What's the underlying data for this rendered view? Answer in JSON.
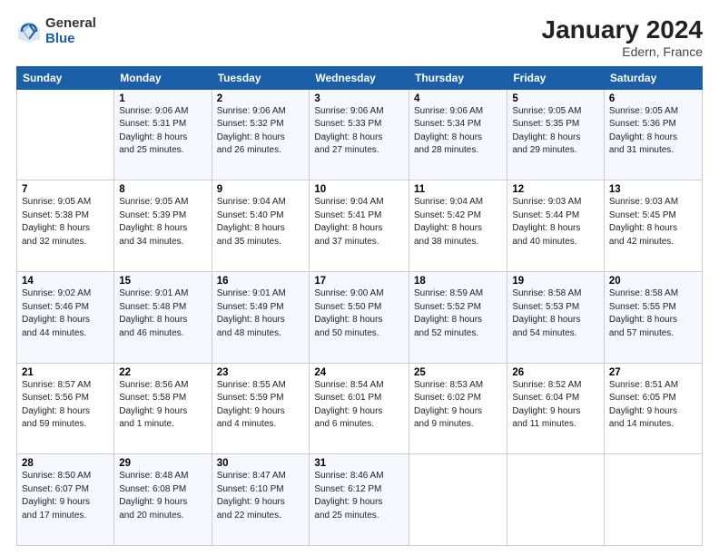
{
  "header": {
    "logo_general": "General",
    "logo_blue": "Blue",
    "title": "January 2024",
    "subtitle": "Edern, France"
  },
  "columns": [
    "Sunday",
    "Monday",
    "Tuesday",
    "Wednesday",
    "Thursday",
    "Friday",
    "Saturday"
  ],
  "weeks": [
    [
      {
        "day": "",
        "info": ""
      },
      {
        "day": "1",
        "info": "Sunrise: 9:06 AM\nSunset: 5:31 PM\nDaylight: 8 hours\nand 25 minutes."
      },
      {
        "day": "2",
        "info": "Sunrise: 9:06 AM\nSunset: 5:32 PM\nDaylight: 8 hours\nand 26 minutes."
      },
      {
        "day": "3",
        "info": "Sunrise: 9:06 AM\nSunset: 5:33 PM\nDaylight: 8 hours\nand 27 minutes."
      },
      {
        "day": "4",
        "info": "Sunrise: 9:06 AM\nSunset: 5:34 PM\nDaylight: 8 hours\nand 28 minutes."
      },
      {
        "day": "5",
        "info": "Sunrise: 9:05 AM\nSunset: 5:35 PM\nDaylight: 8 hours\nand 29 minutes."
      },
      {
        "day": "6",
        "info": "Sunrise: 9:05 AM\nSunset: 5:36 PM\nDaylight: 8 hours\nand 31 minutes."
      }
    ],
    [
      {
        "day": "7",
        "info": "Sunrise: 9:05 AM\nSunset: 5:38 PM\nDaylight: 8 hours\nand 32 minutes."
      },
      {
        "day": "8",
        "info": "Sunrise: 9:05 AM\nSunset: 5:39 PM\nDaylight: 8 hours\nand 34 minutes."
      },
      {
        "day": "9",
        "info": "Sunrise: 9:04 AM\nSunset: 5:40 PM\nDaylight: 8 hours\nand 35 minutes."
      },
      {
        "day": "10",
        "info": "Sunrise: 9:04 AM\nSunset: 5:41 PM\nDaylight: 8 hours\nand 37 minutes."
      },
      {
        "day": "11",
        "info": "Sunrise: 9:04 AM\nSunset: 5:42 PM\nDaylight: 8 hours\nand 38 minutes."
      },
      {
        "day": "12",
        "info": "Sunrise: 9:03 AM\nSunset: 5:44 PM\nDaylight: 8 hours\nand 40 minutes."
      },
      {
        "day": "13",
        "info": "Sunrise: 9:03 AM\nSunset: 5:45 PM\nDaylight: 8 hours\nand 42 minutes."
      }
    ],
    [
      {
        "day": "14",
        "info": "Sunrise: 9:02 AM\nSunset: 5:46 PM\nDaylight: 8 hours\nand 44 minutes."
      },
      {
        "day": "15",
        "info": "Sunrise: 9:01 AM\nSunset: 5:48 PM\nDaylight: 8 hours\nand 46 minutes."
      },
      {
        "day": "16",
        "info": "Sunrise: 9:01 AM\nSunset: 5:49 PM\nDaylight: 8 hours\nand 48 minutes."
      },
      {
        "day": "17",
        "info": "Sunrise: 9:00 AM\nSunset: 5:50 PM\nDaylight: 8 hours\nand 50 minutes."
      },
      {
        "day": "18",
        "info": "Sunrise: 8:59 AM\nSunset: 5:52 PM\nDaylight: 8 hours\nand 52 minutes."
      },
      {
        "day": "19",
        "info": "Sunrise: 8:58 AM\nSunset: 5:53 PM\nDaylight: 8 hours\nand 54 minutes."
      },
      {
        "day": "20",
        "info": "Sunrise: 8:58 AM\nSunset: 5:55 PM\nDaylight: 8 hours\nand 57 minutes."
      }
    ],
    [
      {
        "day": "21",
        "info": "Sunrise: 8:57 AM\nSunset: 5:56 PM\nDaylight: 8 hours\nand 59 minutes."
      },
      {
        "day": "22",
        "info": "Sunrise: 8:56 AM\nSunset: 5:58 PM\nDaylight: 9 hours\nand 1 minute."
      },
      {
        "day": "23",
        "info": "Sunrise: 8:55 AM\nSunset: 5:59 PM\nDaylight: 9 hours\nand 4 minutes."
      },
      {
        "day": "24",
        "info": "Sunrise: 8:54 AM\nSunset: 6:01 PM\nDaylight: 9 hours\nand 6 minutes."
      },
      {
        "day": "25",
        "info": "Sunrise: 8:53 AM\nSunset: 6:02 PM\nDaylight: 9 hours\nand 9 minutes."
      },
      {
        "day": "26",
        "info": "Sunrise: 8:52 AM\nSunset: 6:04 PM\nDaylight: 9 hours\nand 11 minutes."
      },
      {
        "day": "27",
        "info": "Sunrise: 8:51 AM\nSunset: 6:05 PM\nDaylight: 9 hours\nand 14 minutes."
      }
    ],
    [
      {
        "day": "28",
        "info": "Sunrise: 8:50 AM\nSunset: 6:07 PM\nDaylight: 9 hours\nand 17 minutes."
      },
      {
        "day": "29",
        "info": "Sunrise: 8:48 AM\nSunset: 6:08 PM\nDaylight: 9 hours\nand 20 minutes."
      },
      {
        "day": "30",
        "info": "Sunrise: 8:47 AM\nSunset: 6:10 PM\nDaylight: 9 hours\nand 22 minutes."
      },
      {
        "day": "31",
        "info": "Sunrise: 8:46 AM\nSunset: 6:12 PM\nDaylight: 9 hours\nand 25 minutes."
      },
      {
        "day": "",
        "info": ""
      },
      {
        "day": "",
        "info": ""
      },
      {
        "day": "",
        "info": ""
      }
    ]
  ]
}
